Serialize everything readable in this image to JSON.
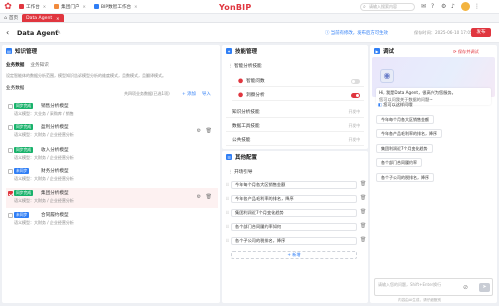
{
  "topbar": {
    "tabs": [
      {
        "label": "工作台",
        "color": "#e0363f"
      },
      {
        "label": "集团门户",
        "color": "#f08a3c"
      },
      {
        "label": "BIP数智工作台",
        "color": "#2f7ef5"
      }
    ],
    "brand": "YonBIP",
    "search_placeholder": "请输入搜索内容"
  },
  "tabbar": {
    "tabs": [
      "首页",
      "Data Agent"
    ]
  },
  "header": {
    "title": "Data Agent",
    "status": "当前有修改，发布后方可生效",
    "save_time": "保存时间：2025-06-10 17:05:40",
    "publish_label": "发布"
  },
  "knowledge": {
    "title": "知识管理",
    "subtabs": [
      "业务数据",
      "业务知识"
    ],
    "description": "设定智能体的数据分析范围，模型知识告诉模型分析的维度模式，且数模式，且翻译模式。",
    "section_label": "业务数据",
    "select_hint": "共四项业务数据(已选1项)",
    "add_label": "+ 添加",
    "import_label": "导入",
    "items": [
      {
        "tag": "同步完成",
        "tag_color": "#19b26b",
        "name": "销售分析模型",
        "desc": "语义模型：大业务 / 采购库 / 销售",
        "checked": false
      },
      {
        "tag": "同步完成",
        "tag_color": "#19b26b",
        "name": "盈利分析模型",
        "desc": "语义模型：大财务 / 企业经营分析",
        "checked": false
      },
      {
        "tag": "同步完成",
        "tag_color": "#19b26b",
        "name": "收入分析模型",
        "desc": "语义模型：大财务 / 企业经营分析",
        "checked": false
      },
      {
        "tag": "未同步",
        "tag_color": "#2f7ef5",
        "name": "财务分析模型",
        "desc": "语义模型：大财务 / 企业经营分析",
        "checked": false
      },
      {
        "tag": "同步完成",
        "tag_color": "#19b26b",
        "name": "集团分析模型",
        "desc": "语义模型：大财务 / 企业经营分析",
        "checked": true
      },
      {
        "tag": "未同步",
        "tag_color": "#2f7ef5",
        "name": "合同履约模型",
        "desc": "语义模型：大财务 / 企业经营分析",
        "checked": false
      }
    ]
  },
  "skills": {
    "title": "技能管理",
    "group_label": "智能分析技能",
    "items": [
      {
        "label": "智能问数",
        "on": false
      },
      {
        "label": "洞察分析",
        "on": true
      }
    ],
    "rows": [
      {
        "label": "知识分析技能",
        "status": "开发中"
      },
      {
        "label": "数据工具技能",
        "status": "开发中"
      },
      {
        "label": "公共技能",
        "status": "开发中"
      }
    ]
  },
  "config": {
    "title": "其他配置",
    "group_label": "开场引导",
    "questions": [
      "今年每个月各大区销售金额",
      "今年各产品毛利率的排名，降序",
      "集团利润近7个月变化趋势",
      "各个部门合同履约率如何",
      "各个子公司的税排名，降序"
    ],
    "add_label": "+ 新增"
  },
  "debug": {
    "title": "调试",
    "save_label": "保存并调试",
    "greeting": "Hi, 我是Data Agent，很高兴为您服务。",
    "greeting_sub": "您可以问我关于数据的问题~",
    "suggest_header": "您可以这样问哦",
    "suggestions": [
      "今年每个月各大区销售金额",
      "今年各产品毛利率的排名，降序",
      "集团利润近7个月变化趋势",
      "各个部门合同履约率",
      "各个子公司的税排名，降序"
    ],
    "input_placeholder": "请输入您的问题，Shift+Enter换行",
    "footer_note": "内容由AI生成，请仔细甄别"
  },
  "colors": {
    "accent": "#e0363f",
    "link": "#2f7ef5",
    "success": "#19b26b"
  }
}
